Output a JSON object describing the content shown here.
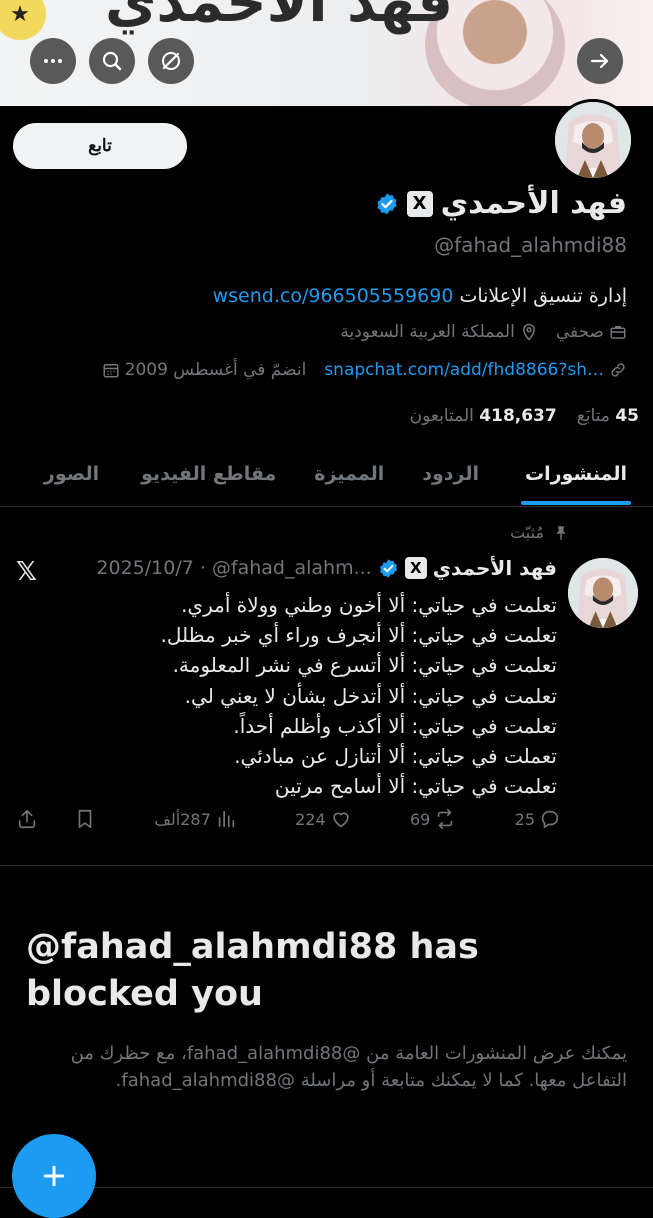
{
  "banner": {
    "title": "فهد الأحمدي"
  },
  "header_buttons": {
    "more_icon": "more-horizontal-icon",
    "search_icon": "search-icon",
    "grok_icon": "grok-icon",
    "share_icon": "arrow-right-icon"
  },
  "profile": {
    "follow_label": "تابع",
    "name": "فهد الأحمدي",
    "handle": "@fahad_alahmdi88",
    "bio_text": "إدارة تنسيق الإعلانات",
    "bio_link": "wsend.co/966505559690",
    "category": "صحفي",
    "location": "المملكة العربية السعودية",
    "website": "snapchat.com/add/fhd8866?sh…",
    "joined": "انضمّ في أغسطس 2009",
    "following_count": "45",
    "following_label": "متابَع",
    "followers_count": "418,637",
    "followers_label": "المتابعون"
  },
  "tabs": [
    {
      "label": "المنشورات"
    },
    {
      "label": "الردود"
    },
    {
      "label": "المميزة"
    },
    {
      "label": "مقاطع الفيديو"
    },
    {
      "label": "الصور"
    }
  ],
  "post": {
    "pinned_label": "مُثبّت",
    "author": "فهد الأحمدي",
    "handle": "@fahad_alahm...",
    "date": "2025/10/7 ·",
    "lines": [
      "تعلمت في حياتي: ألا أخون وطني وولاة أمري.",
      "تعلمت في حياتي: ألا أنجرف وراء أي خبر مظلل.",
      "تعلمت في حياتي: ألا أتسرع في نشر المعلومة.",
      "تعلمت في حياتي: ألا أتدخل بشأن لا يعني لي.",
      "تعلمت في حياتي: ألا أكذب وأظلم أحداً.",
      "تعملت في حياتي: ألا أتنازل عن مبادئي.",
      "تعلمت في حياتي: ألا أسامح مرتين"
    ],
    "replies": "25",
    "reposts": "69",
    "likes": "224",
    "views": "287ألف"
  },
  "blocked": {
    "title": "@fahad_alahmdi88 has blocked you",
    "description": "يمكنك عرض المنشورات العامة من @fahad_alahmdi88، مع حظرك من التفاعل معها. كما لا يمكنك متابعة أو مراسلة @fahad_alahmdi88."
  },
  "colors": {
    "accent": "#1d9bf0",
    "background": "#000000",
    "muted": "#71767b"
  }
}
